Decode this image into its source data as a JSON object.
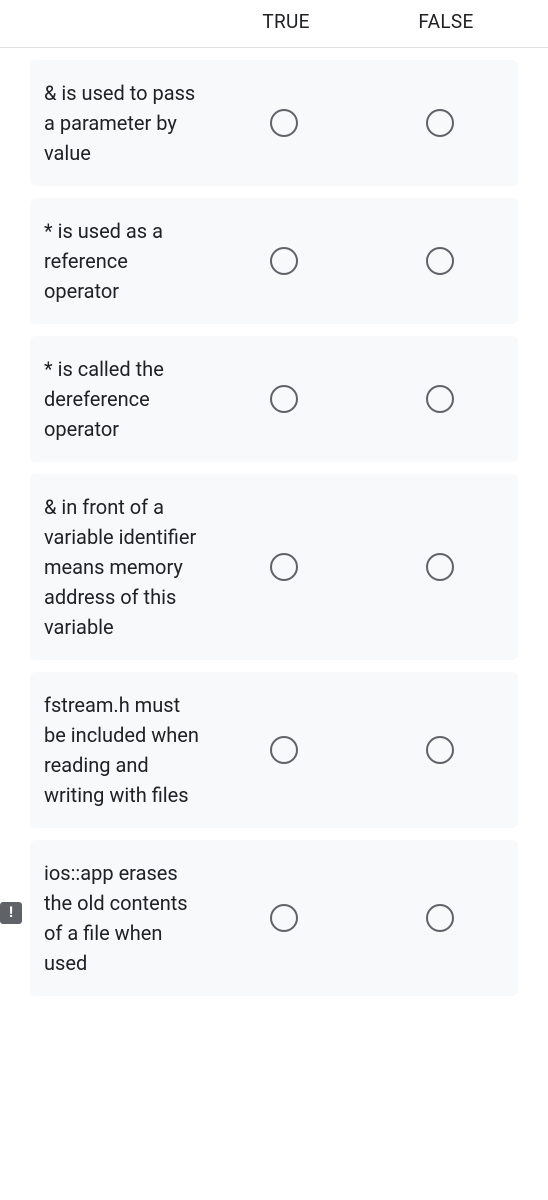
{
  "header": {
    "col_true": "TRUE",
    "col_false": "FALSE"
  },
  "questions": [
    {
      "text": "& is used to pass a parameter by value",
      "alert": false
    },
    {
      "text": "* is used as a reference operator",
      "alert": false
    },
    {
      "text": "* is called the dereference operator",
      "alert": false
    },
    {
      "text": "& in front of a variable identifier means memory address of this variable",
      "alert": false
    },
    {
      "text": "fstream.h must be included when reading and writing with files",
      "alert": false
    },
    {
      "text": "ios::app erases the old contents of a file when used",
      "alert": true
    }
  ]
}
